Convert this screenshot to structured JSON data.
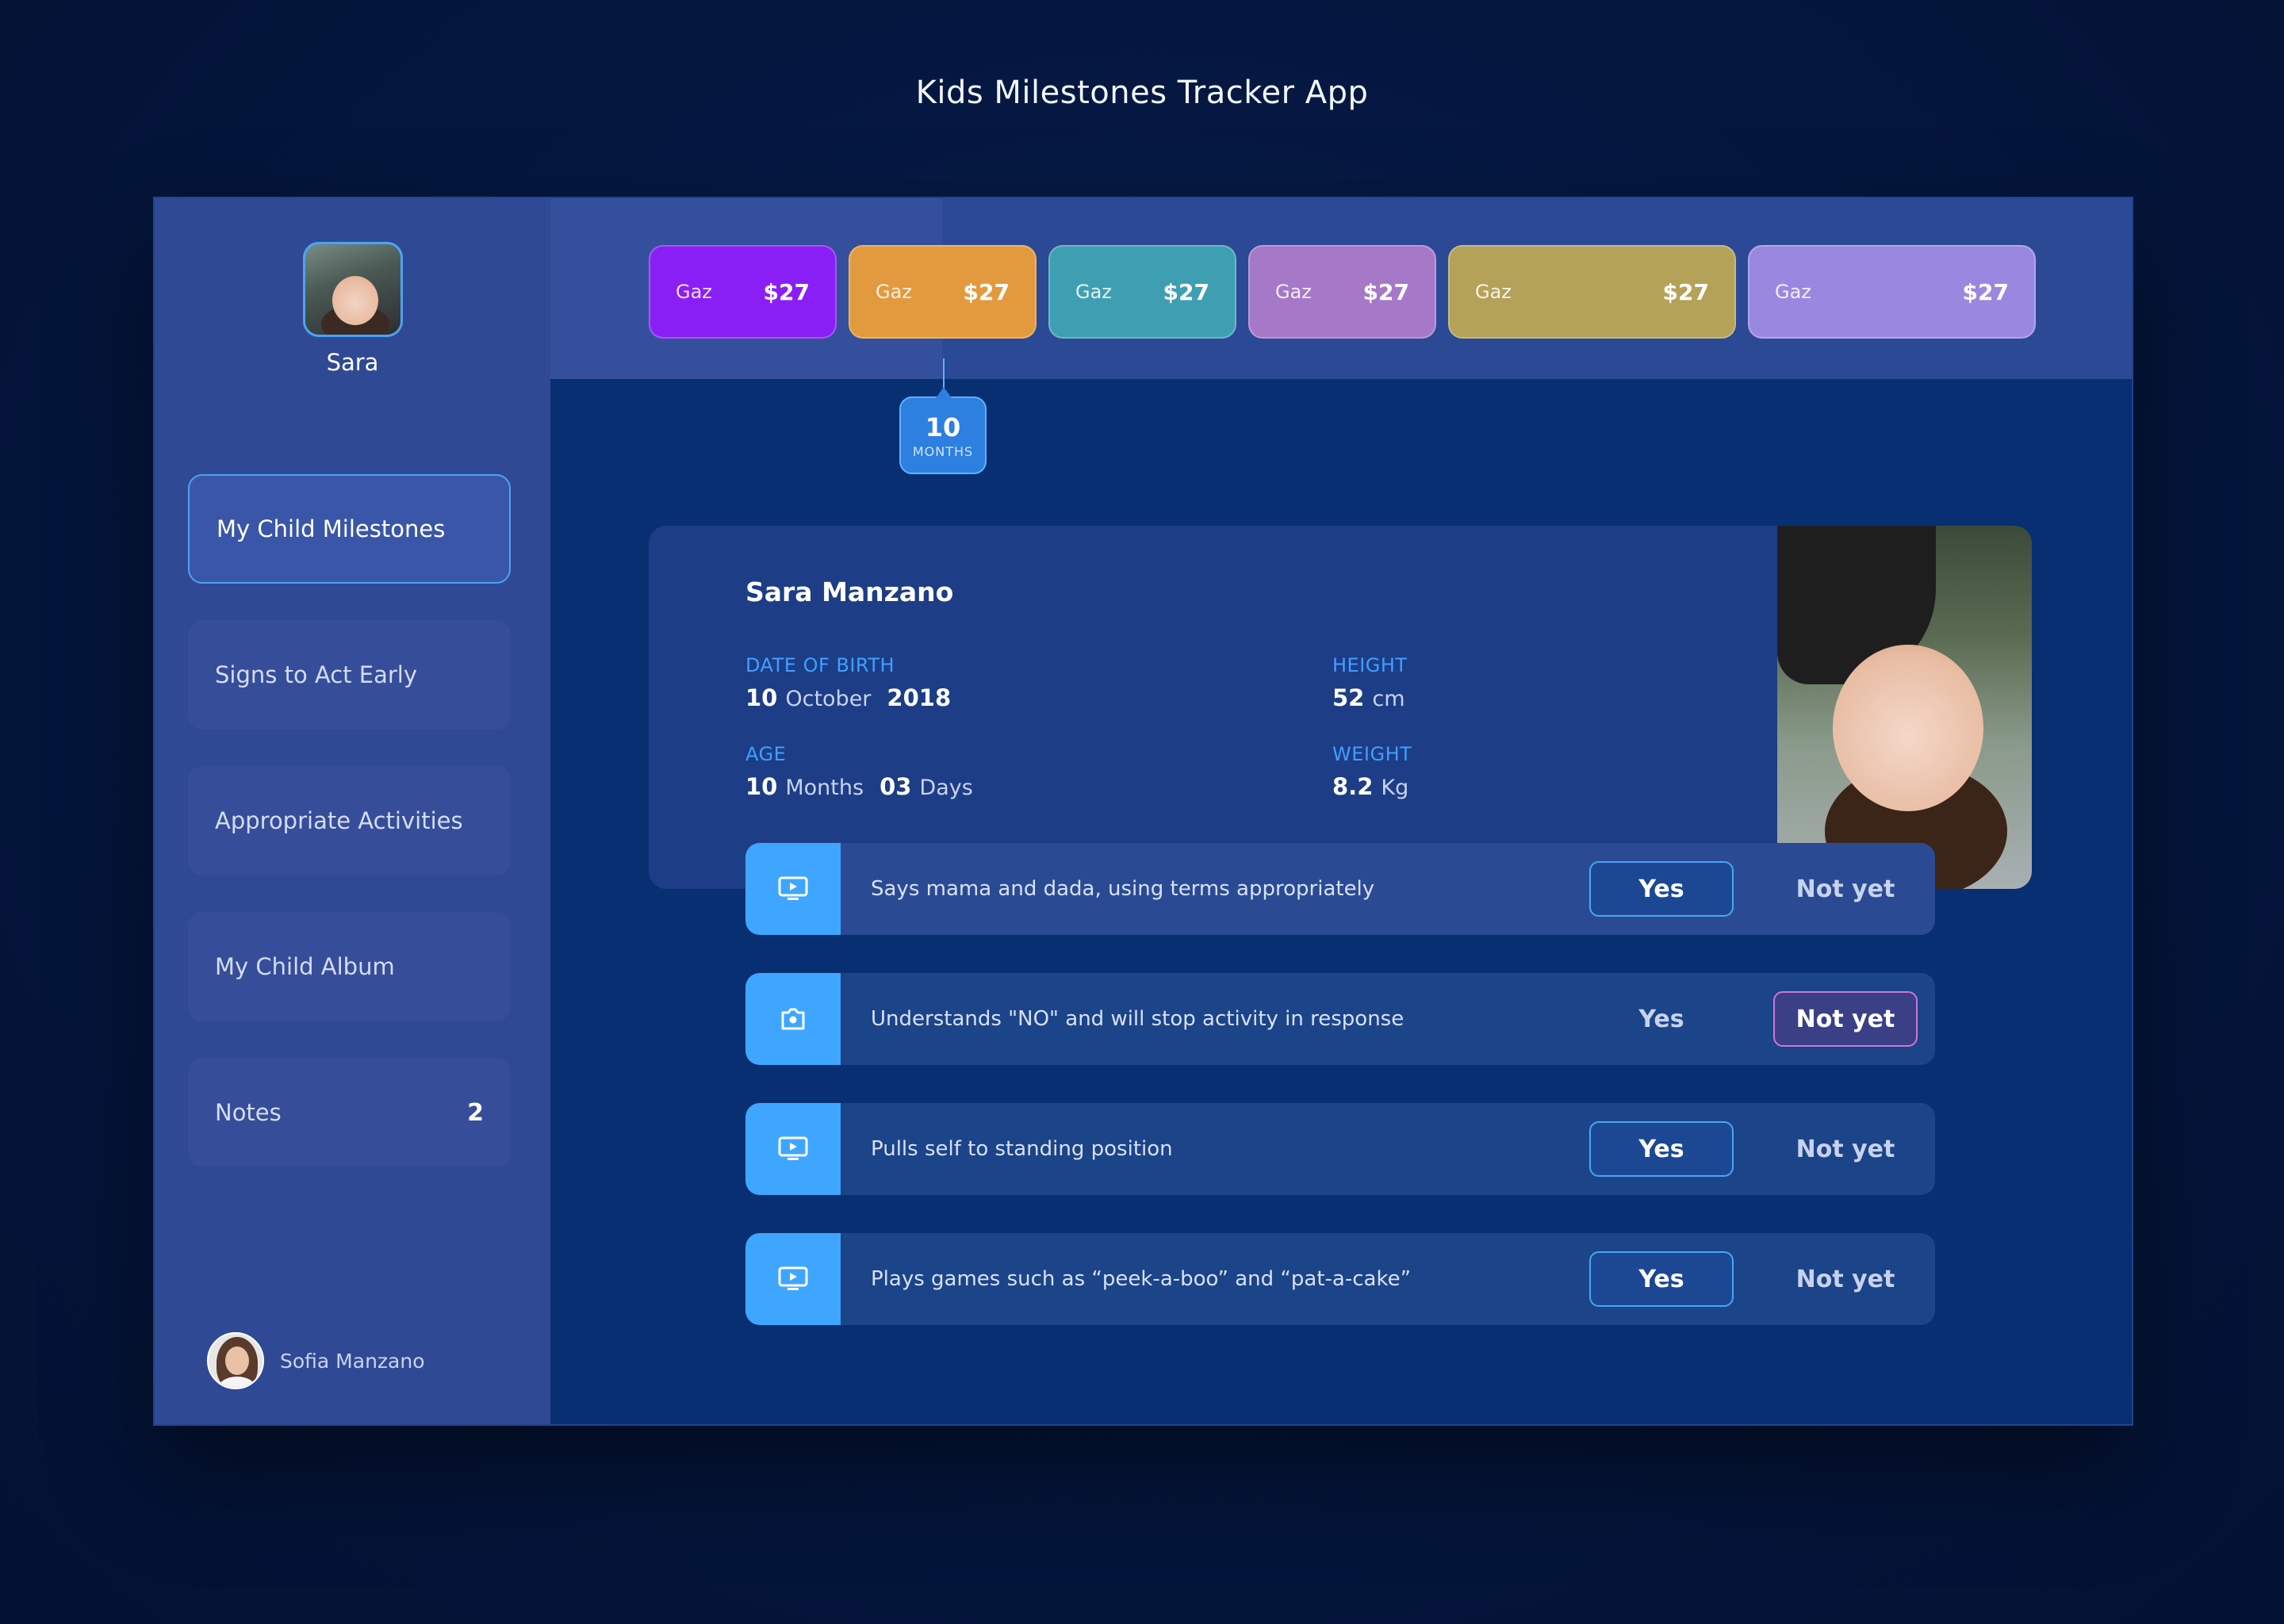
{
  "page_title": "Kids Milestones Tracker App",
  "sidebar": {
    "child_name": "Sara",
    "items": [
      {
        "label": "My Child Milestones",
        "active": true
      },
      {
        "label": "Signs to Act Early"
      },
      {
        "label": "Appropriate Activities"
      },
      {
        "label": "My Child Album"
      },
      {
        "label": "Notes",
        "count": "2"
      }
    ],
    "user_name": "Sofia Manzano"
  },
  "months": [
    {
      "label": "Gaz",
      "amount": "$27",
      "color": "#8a1ff5"
    },
    {
      "label": "Gaz",
      "amount": "$27",
      "color": "#e39a3e"
    },
    {
      "label": "Gaz",
      "amount": "$27",
      "color": "#3f9fb2"
    },
    {
      "label": "Gaz",
      "amount": "$27",
      "color": "#a678c8"
    },
    {
      "label": "Gaz",
      "amount": "$27",
      "color": "#b4a259"
    },
    {
      "label": "Gaz",
      "amount": "$27",
      "color": "#9a88e0"
    }
  ],
  "current_age_marker": {
    "value": "10",
    "unit": "MONTHS"
  },
  "profile": {
    "name": "Sara Manzano",
    "dob": {
      "label": "DATE OF BIRTH",
      "day": "10",
      "month": "October",
      "year": "2018"
    },
    "height": {
      "label": "HEIGHT",
      "value": "52",
      "unit": "cm"
    },
    "age": {
      "label": "AGE",
      "months": "10",
      "months_unit": "Months",
      "days": "03",
      "days_unit": "Days"
    },
    "weight": {
      "label": "WEIGHT",
      "value": "8.2",
      "unit": "Kg"
    }
  },
  "milestones": [
    {
      "text": "Says mama and dada, using terms appropriately",
      "icon": "play-icon",
      "answer": "yes"
    },
    {
      "text": "Understands \"NO\" and will stop activity in response",
      "icon": "camera-icon",
      "answer": "not_yet"
    },
    {
      "text": "Pulls self to standing position",
      "icon": "play-icon",
      "answer": "yes"
    },
    {
      "text": "Plays games such as “peek-a-boo” and “pat-a-cake”",
      "icon": "play-icon",
      "answer": "yes"
    }
  ],
  "buttons": {
    "yes_label": "Yes",
    "no_label": "Not yet"
  },
  "colors": {
    "accent": "#3ea6ff",
    "not_yet_border": "#d274d8",
    "background": "#051740"
  }
}
